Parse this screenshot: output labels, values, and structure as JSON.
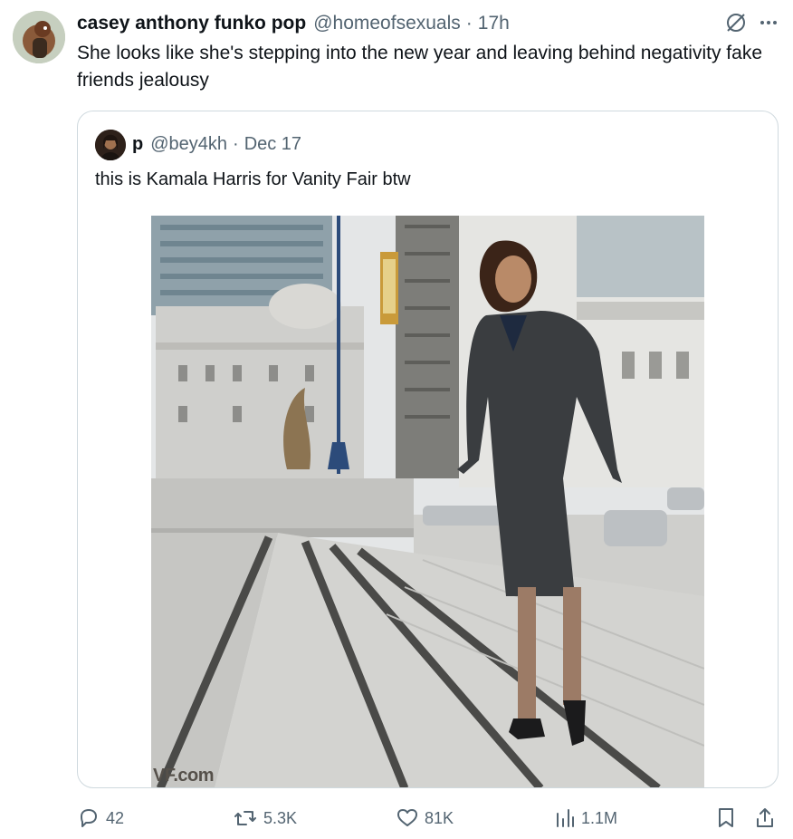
{
  "tweet": {
    "author_name": "casey anthony funko pop",
    "author_handle": "@homeofsexuals",
    "separator": "·",
    "time": "17h",
    "text": "She looks like she's stepping into the new year and leaving behind negativity fake friends jealousy"
  },
  "quoted_tweet": {
    "author_name": "p",
    "author_handle": "@bey4kh",
    "separator": "·",
    "time": "Dec 17",
    "text": "this is Kamala Harris for Vanity Fair btw",
    "image_watermark": "VF.com"
  },
  "actions": {
    "replies": "42",
    "reposts": "5.3K",
    "likes": "81K",
    "views": "1.1M"
  },
  "icons": {
    "top_right": [
      "grok-icon",
      "more-options-icon"
    ],
    "action_bar": [
      "reply-icon",
      "repost-icon",
      "like-icon",
      "views-icon",
      "bookmark-icon",
      "share-icon"
    ]
  },
  "colors": {
    "text_primary": "#0f1419",
    "text_secondary": "#536471",
    "border": "#cfd9de"
  }
}
